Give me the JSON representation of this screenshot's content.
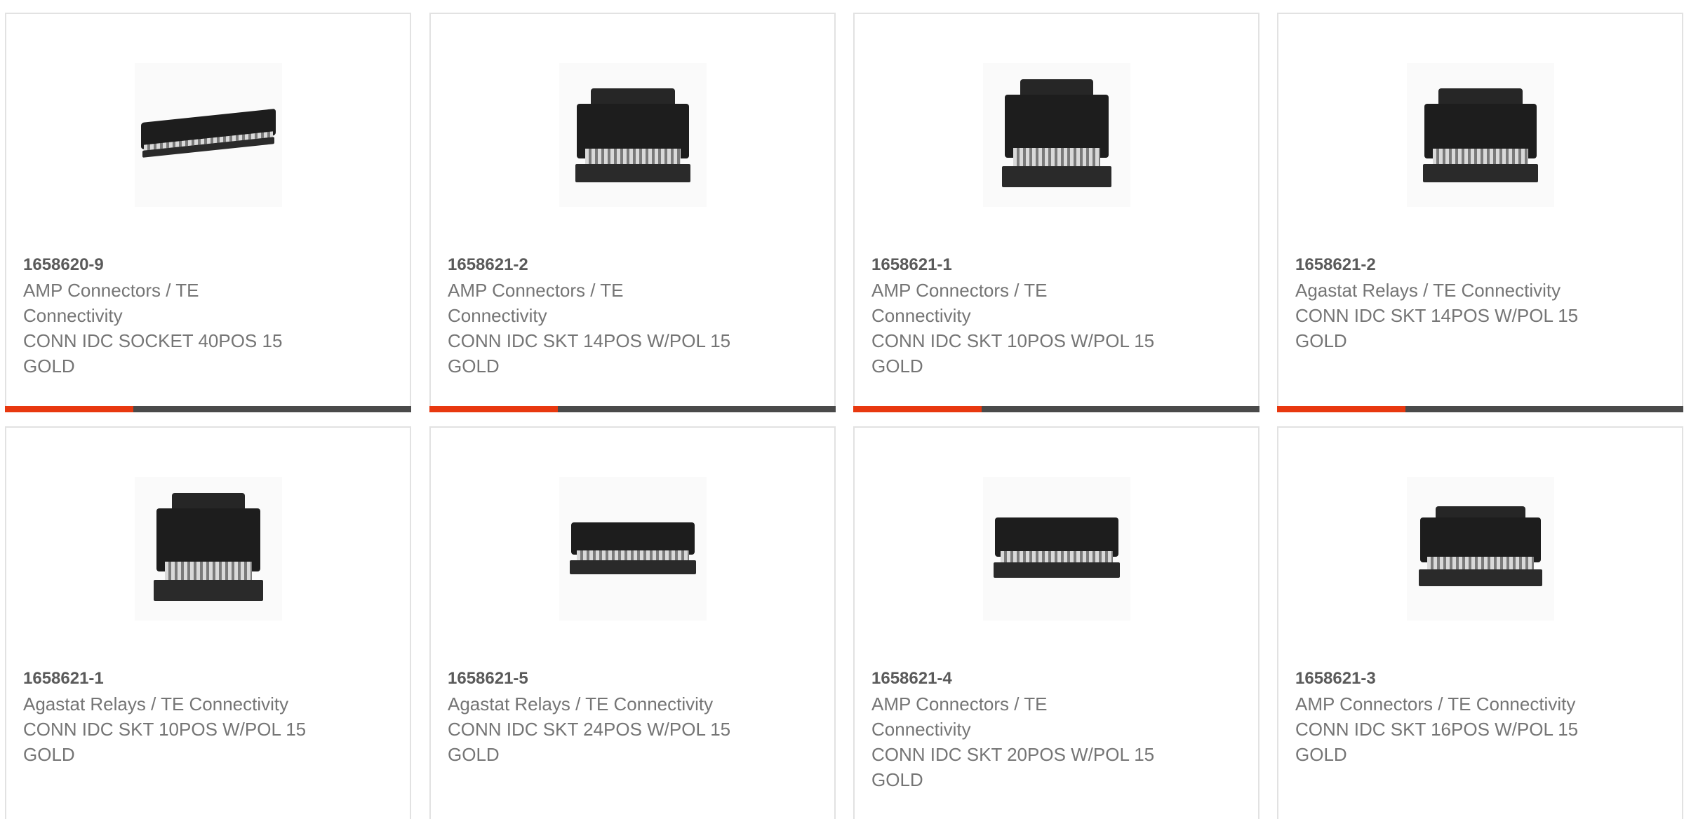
{
  "products": [
    {
      "part": "1658620-9",
      "manufacturer": "AMP Connectors / TE Connectivity",
      "description": "CONN IDC SOCKET 40POS 15 GOLD",
      "image_icon": "idc-socket-40pos-icon",
      "accent_color": "#e8380f"
    },
    {
      "part": "1658621-2",
      "manufacturer": "AMP Connectors / TE Connectivity",
      "description": "CONN IDC SKT 14POS W/POL 15 GOLD",
      "image_icon": "idc-socket-14pos-icon",
      "accent_color": "#e8380f"
    },
    {
      "part": "1658621-1",
      "manufacturer": "AMP Connectors / TE Connectivity",
      "description": "CONN IDC SKT 10POS W/POL 15 GOLD",
      "image_icon": "idc-socket-10pos-icon",
      "accent_color": "#e8380f"
    },
    {
      "part": "1658621-2",
      "manufacturer": "Agastat Relays / TE Connectivity",
      "description": "CONN IDC SKT 14POS W/POL 15 GOLD",
      "image_icon": "idc-socket-14pos-icon",
      "accent_color": "#e8380f"
    },
    {
      "part": "1658621-1",
      "manufacturer": "Agastat Relays / TE Connectivity",
      "description": "CONN IDC SKT 10POS W/POL 15 GOLD",
      "image_icon": "idc-socket-10pos-icon"
    },
    {
      "part": "1658621-5",
      "manufacturer": "Agastat Relays / TE Connectivity",
      "description": "CONN IDC SKT 24POS W/POL 15 GOLD",
      "image_icon": "idc-socket-24pos-icon"
    },
    {
      "part": "1658621-4",
      "manufacturer": "AMP Connectors / TE Connectivity",
      "description": "CONN IDC SKT 20POS W/POL 15 GOLD",
      "image_icon": "idc-socket-20pos-icon"
    },
    {
      "part": "1658621-3",
      "manufacturer": "AMP Connectors / TE Connectivity",
      "description": "CONN IDC SKT 16POS W/POL 15 GOLD",
      "image_icon": "idc-socket-16pos-icon"
    }
  ],
  "colors": {
    "accent": "#e8380f",
    "bar": "#4a4a4a",
    "border": "#e2e2e2",
    "text": "#757575"
  }
}
